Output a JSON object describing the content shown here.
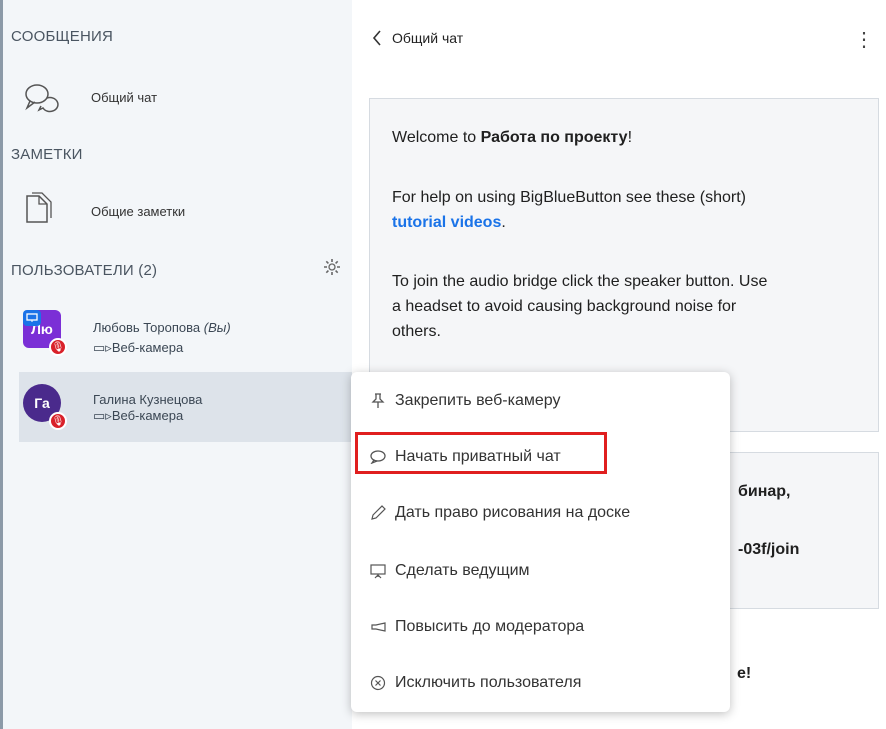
{
  "sidebar": {
    "messages_title": "СООБЩЕНИЯ",
    "public_chat": "Общий чат",
    "notes_title": "ЗАМЕТКИ",
    "shared_notes": "Общие заметки",
    "users_title": "ПОЛЬЗОВАТЕЛИ (2)",
    "users": [
      {
        "initials": "Лю",
        "name": "Любовь Торопова",
        "you": "(Вы)",
        "camera": "Веб-камера",
        "color": "#7b2fd6"
      },
      {
        "initials": "Га",
        "name": "Галина Кузнецова",
        "camera": "Веб-камера",
        "color": "#4a2a8c"
      }
    ]
  },
  "chat": {
    "back_icon": "chevron-left-icon",
    "title": "Общий чат",
    "menu_icon": "kebab-icon",
    "welcome_prefix": "Welcome to ",
    "welcome_room": "Работа по проекту",
    "welcome_suffix": "!",
    "help_text": "For help on using BigBlueButton see these (short)",
    "help_link": "tutorial videos",
    "help_dot": ".",
    "audio_line1": "To join the audio bridge click the speaker button. Use",
    "audio_line2": "a headset to avoid causing background noise for",
    "audio_line3": "others.",
    "fragment1": "бинар,",
    "fragment2": "-03f/join",
    "fragment3": "e!"
  },
  "context_menu": {
    "items": [
      {
        "label": "Закрепить веб-камеру",
        "icon": "pin-icon"
      },
      {
        "label": "Начать приватный чат",
        "icon": "chat-bubble-icon"
      },
      {
        "label": "Дать право рисования на доске",
        "icon": "pencil-icon"
      },
      {
        "label": "Сделать ведущим",
        "icon": "presenter-icon"
      },
      {
        "label": "Повысить до модератора",
        "icon": "promote-icon"
      },
      {
        "label": "Исключить пользователя",
        "icon": "remove-circle-icon"
      }
    ],
    "highlight_color": "#e01f1f"
  }
}
